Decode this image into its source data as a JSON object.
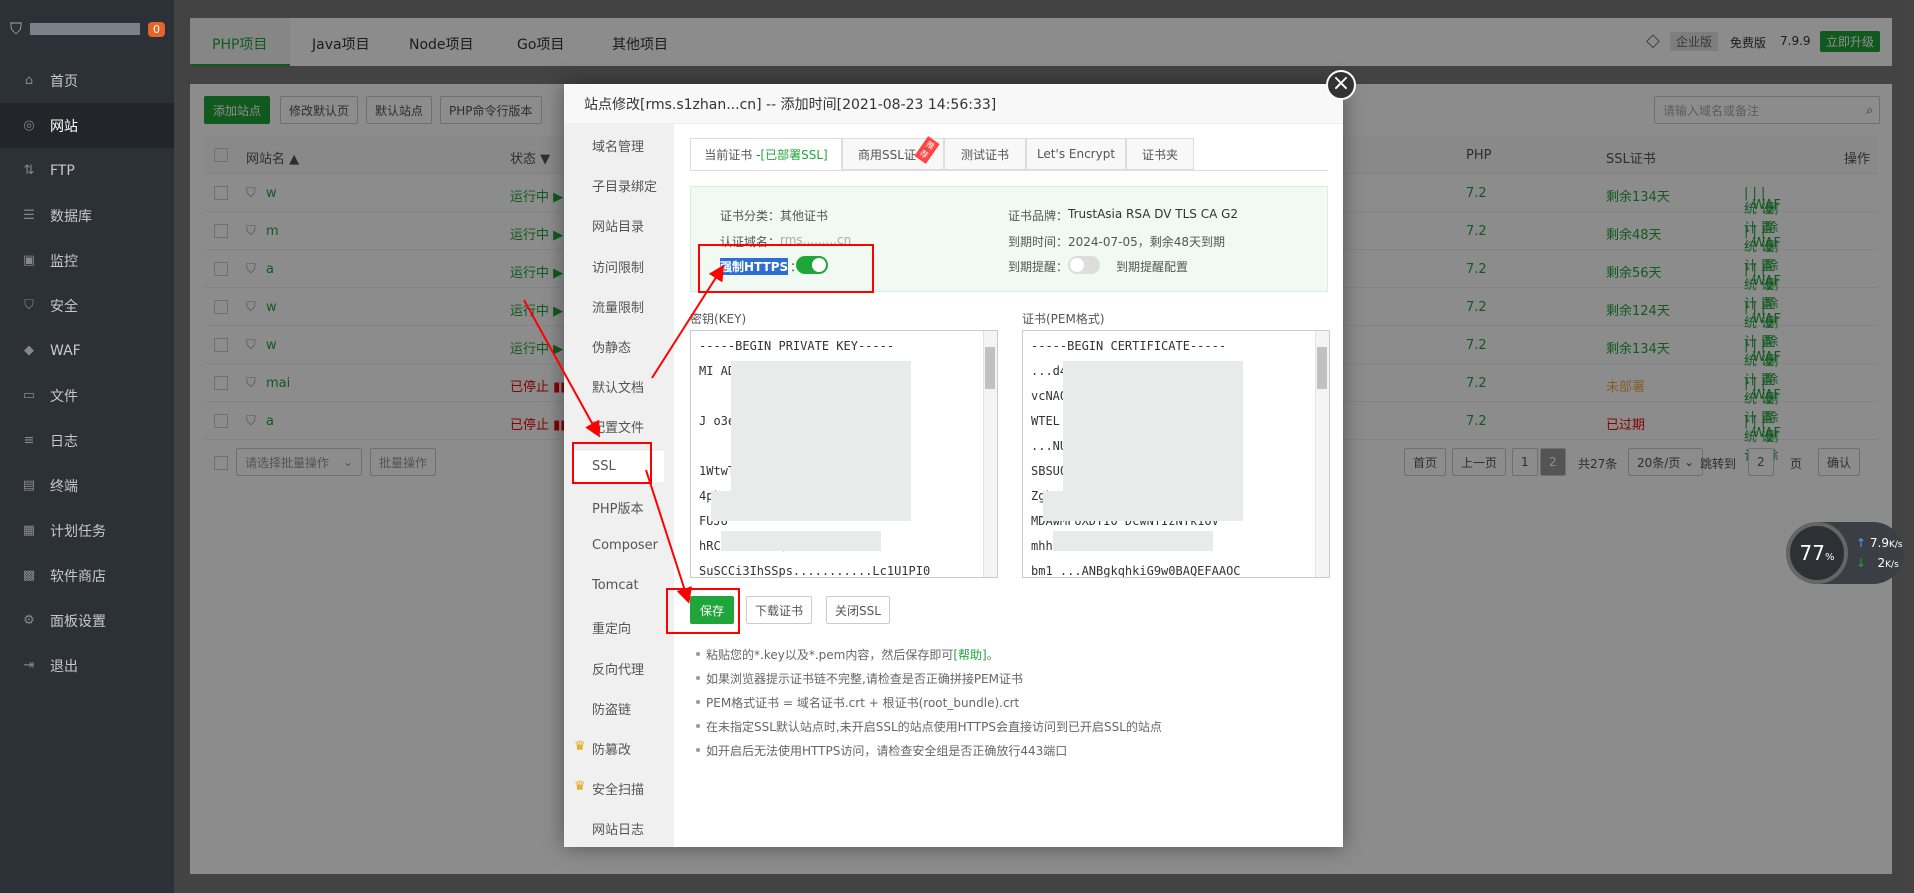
{
  "sidebar": {
    "badge": "0",
    "items": [
      {
        "icon": "home-icon",
        "label": "首页"
      },
      {
        "icon": "globe-icon",
        "label": "网站"
      },
      {
        "icon": "ftp-icon",
        "label": "FTP"
      },
      {
        "icon": "database-icon",
        "label": "数据库"
      },
      {
        "icon": "monitor-icon",
        "label": "监控"
      },
      {
        "icon": "shield-icon",
        "label": "安全"
      },
      {
        "icon": "waf-icon",
        "label": "WAF"
      },
      {
        "icon": "folder-icon",
        "label": "文件"
      },
      {
        "icon": "log-icon",
        "label": "日志"
      },
      {
        "icon": "terminal-icon",
        "label": "终端"
      },
      {
        "icon": "calendar-icon",
        "label": "计划任务"
      },
      {
        "icon": "grid-icon",
        "label": "软件商店"
      },
      {
        "icon": "gear-icon",
        "label": "面板设置"
      },
      {
        "icon": "logout-icon",
        "label": "退出"
      }
    ]
  },
  "topbar": {
    "tabs": [
      "PHP项目",
      "Java项目",
      "Node项目",
      "Go项目",
      "其他项目"
    ],
    "edition": "企业版",
    "free_label": "免费版",
    "version": "7.9.9",
    "upgrade": "立即升级"
  },
  "toolbar": {
    "add_site": "添加站点",
    "edit_default_page": "修改默认页",
    "default_site": "默认站点",
    "php_cli": "PHP命令行版本",
    "search_placeholder": "请输入域名或备注"
  },
  "table": {
    "headers": {
      "name": "网站名 ▲",
      "status": "状态 ▼",
      "php": "PHP",
      "ssl": "SSL证书",
      "ops": "操作"
    },
    "rows": [
      {
        "status": "运行中 ▶",
        "php": "7.2",
        "ssl": "剩余134天"
      },
      {
        "status": "运行中 ▶",
        "php": "7.2",
        "ssl": "剩余48天"
      },
      {
        "status": "运行中 ▶",
        "php": "7.2",
        "ssl": "剩余56天"
      },
      {
        "status": "运行中 ▶",
        "php": "7.2",
        "ssl": "剩余124天"
      },
      {
        "status": "运行中 ▶",
        "php": "7.2",
        "ssl": "剩余134天"
      },
      {
        "status": "已停止 ▮▮",
        "php": "7.2",
        "ssl": "未部署"
      },
      {
        "status": "已停止 ▮▮",
        "php": "7.2",
        "ssl": "已过期"
      }
    ],
    "row_partials": [
      "n",
      "",
      "_cn",
      "",
      "",
      "n",
      ""
    ],
    "row_name_prefix": [
      "w",
      "m",
      "a",
      "w",
      "w",
      "mai",
      "a"
    ],
    "ops": [
      "统计",
      "WAF",
      "设置",
      "删除"
    ],
    "batch_placeholder": "请选择批量操作",
    "batch_button": "批量操作",
    "pagination": {
      "first": "首页",
      "prev": "上一页",
      "p1": "1",
      "p2": "2",
      "total": "共27条",
      "per_page": "20条/页",
      "goto": "跳转到",
      "goto_value": "2",
      "page_unit": "页",
      "confirm": "确认"
    }
  },
  "modal": {
    "title": "站点修改[rms.s1zhan...cn] -- 添加时间[2021-08-23 14:56:33]",
    "menu": [
      "域名管理",
      "子目录绑定",
      "网站目录",
      "访问限制",
      "流量限制",
      "伪静态",
      "默认文档",
      "配置文件",
      "SSL",
      "PHP版本",
      "Composer",
      "Tomcat",
      "重定向",
      "反向代理",
      "防盗链",
      "防篡改",
      "安全扫描",
      "网站日志"
    ],
    "tabs": {
      "current": "当前证书 - ",
      "current_status": "[已部署SSL]",
      "commercial": "商用SSL证书",
      "recommend": "推荐",
      "test": "测试证书",
      "letsencrypt": "Let's Encrypt",
      "folder": "证书夹"
    },
    "info": {
      "cert_type_label": "证书分类：",
      "cert_type": "其他证书",
      "domain_label": "认证域名：",
      "domain": "rms.........cn",
      "force_https": "强制HTTPS",
      "force_https_colon": "：",
      "brand_label": "证书品牌：",
      "brand": "TrustAsia RSA DV TLS CA G2",
      "expire_label": "到期时间：",
      "expire": "2024-07-05，剩余48天到期",
      "remind_label": "到期提醒：",
      "remind_link": "到期提醒配置"
    },
    "key_label": "密钥(KEY)",
    "cert_label": "证书(PEM格式)",
    "key_lines": [
      "-----BEGIN PRIVATE KEY-----",
      "MI                    ADCYC",
      "",
      "J                     o3ezi7d",
      "",
      "1WtwT6Fh      ..up3UBAGUHC6YF7i9gk",
      "4pkxuHGHx+JPCXG9   kZ",
      "FUJU",
      "hRCv                      HXZm46QJ",
      "SuSCCi3IhSSps...........Lc1U1PI0"
    ],
    "cert_lines": [
      "-----BEGIN CERTIFICATE-----",
      "            ...d4",
      "              vcNAQEMBQAv",
      "WTEL          ..AJBhNVBAoTHFR",
      "...NUOXN         ...vls",
      "               SBSU0",
      "Zgkm gVLxHEH",
      "              MDAwMFoXDTI0    DcwNTIzNTk1OV",
      "                          mhh",
      "bm1          ...ANBgkqhkiG9w0BAQEFAAOC"
    ],
    "save": "保存",
    "download": "下载证书",
    "close_ssl": "关闭SSL",
    "tips": [
      {
        "text": "粘贴您的*.key以及*.pem内容，然后保存即可",
        "link": "[帮助]",
        "end": "。"
      },
      {
        "text": "如果浏览器提示证书链不完整,请检查是否正确拼接PEM证书",
        "link": "",
        "end": ""
      },
      {
        "text": "PEM格式证书 = 域名证书.crt + 根证书(root_bundle).crt",
        "link": "",
        "end": ""
      },
      {
        "text": "在未指定SSL默认站点时,未开启SSL的站点使用HTTPS会直接访问到已开启SSL的站点",
        "link": "",
        "end": ""
      },
      {
        "text": "如开启后无法使用HTTPS访问，请检查安全组是否正确放行443端口",
        "link": "",
        "end": ""
      }
    ]
  },
  "speed": {
    "percent": "77",
    "percent_unit": "%",
    "up": "7.9",
    "down": "2",
    "unit": "K/s"
  },
  "colors": {
    "accent": "#20a53a",
    "danger": "#ef0808",
    "warn": "#f0ad4e",
    "sidebar": "#2c3138"
  }
}
